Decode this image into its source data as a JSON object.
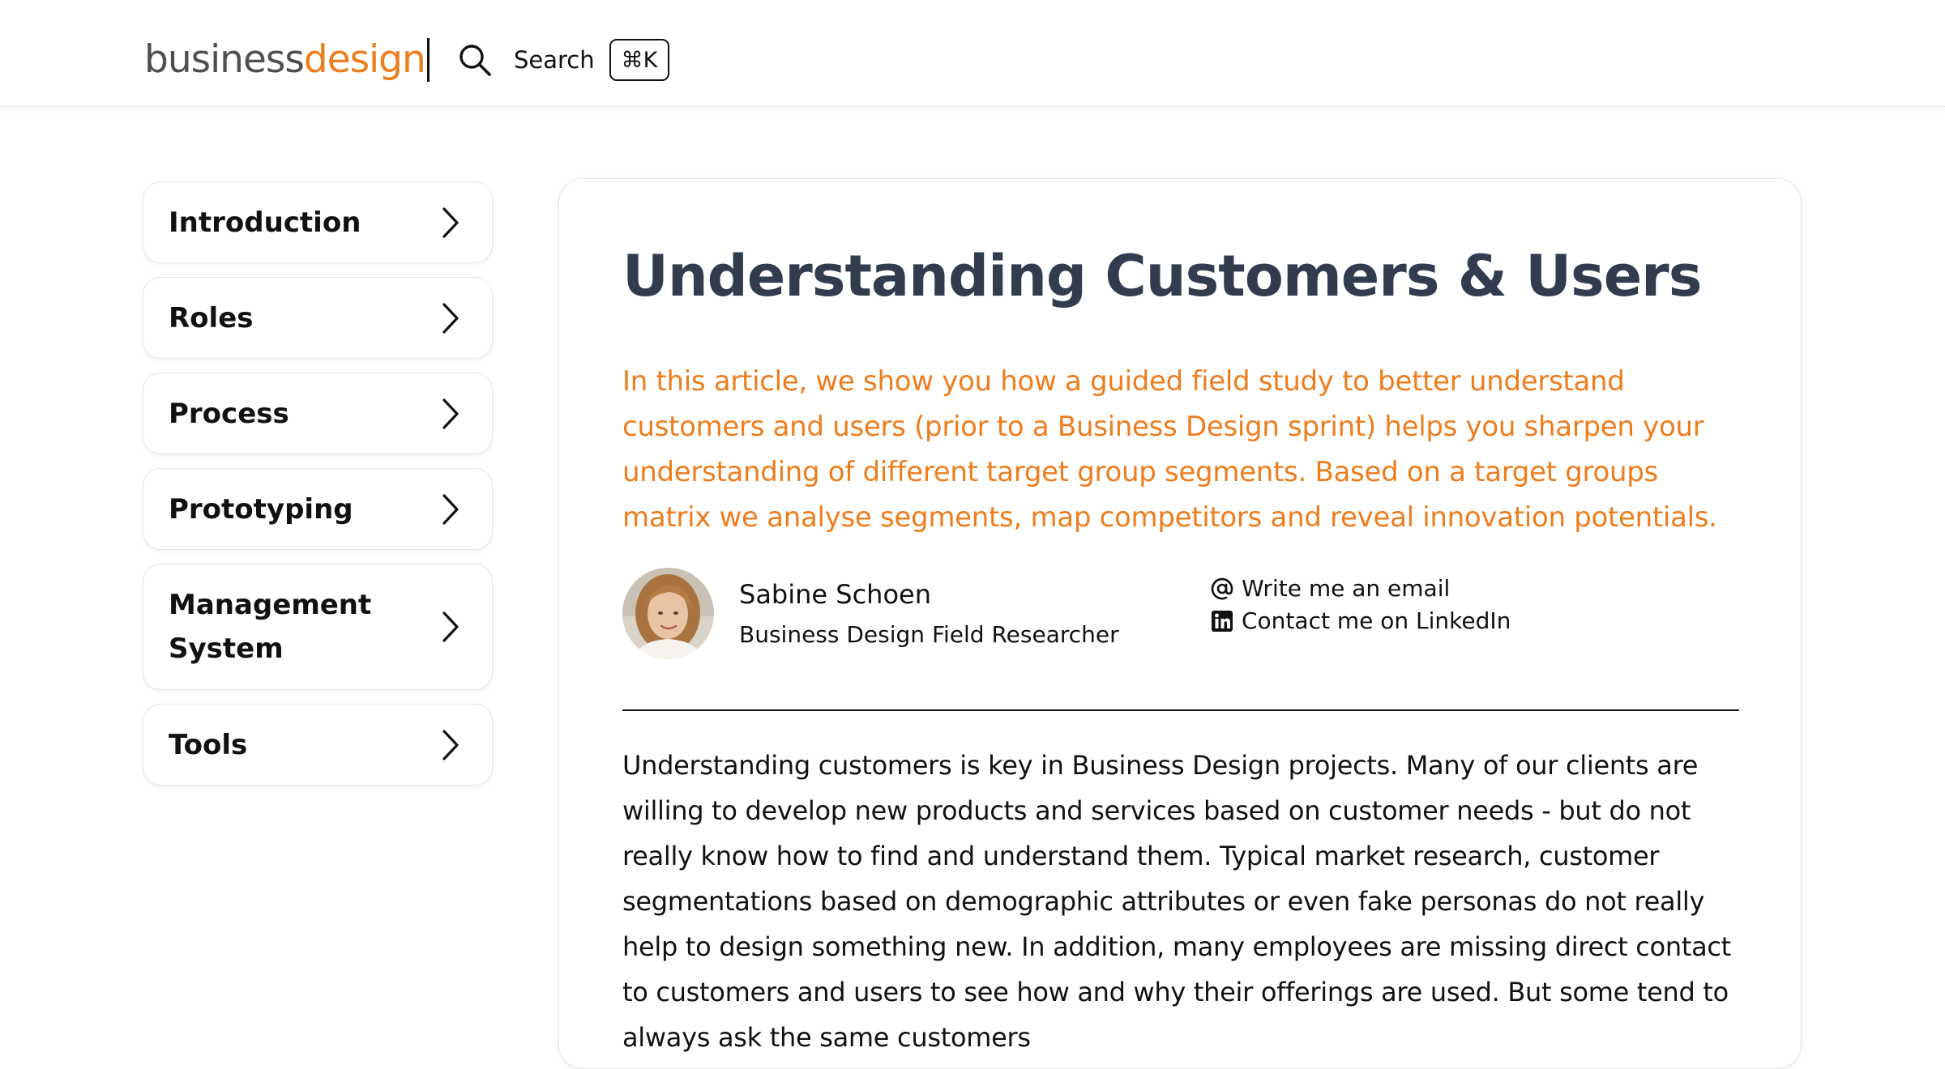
{
  "header": {
    "logo_part_1": "business",
    "logo_part_2": "design",
    "search_label": "Search",
    "search_shortcut": "⌘K",
    "icons": {
      "search": "search-icon"
    }
  },
  "sidebar": {
    "items": [
      {
        "label": "Introduction",
        "icon": "chevron-right-icon"
      },
      {
        "label": "Roles",
        "icon": "chevron-right-icon"
      },
      {
        "label": "Process",
        "icon": "chevron-right-icon"
      },
      {
        "label": "Prototyping",
        "icon": "chevron-right-icon"
      },
      {
        "label": "Management System",
        "icon": "chevron-right-icon"
      },
      {
        "label": "Tools",
        "icon": "chevron-right-icon"
      }
    ]
  },
  "article": {
    "title": "Understanding Customers & Users",
    "lead": "In this article, we show you how a guided field study to better understand customers and users (prior to a Business Design sprint) helps you sharpen your understanding of different target group segments. Based on a target groups matrix we analyse segments, map competitors and reveal innovation potentials.",
    "author": {
      "name": "Sabine Schoen",
      "role": "Business Design Field Researcher",
      "avatar": "author-avatar"
    },
    "contact": {
      "email_label": "Write me an email",
      "email_icon": "at-sign-icon",
      "linkedin_label": "Contact me on LinkedIn",
      "linkedin_icon": "linkedin-icon"
    },
    "body": "Understanding customers is key in Business Design projects. Many of our clients are willing to develop new products and services based on customer needs - but do not really know how to find and understand them. Typical market research, customer segmentations based on demographic attributes or even fake personas do not really help to design something new. In addition, many employees are missing direct contact to customers and users to see how and why their offerings are used. But some tend to always ask the same customers"
  },
  "colors": {
    "brand_orange": "#ee7d1d",
    "title_slate": "#323c4f",
    "text": "#111111",
    "logo_gray": "#4f4f4f"
  }
}
